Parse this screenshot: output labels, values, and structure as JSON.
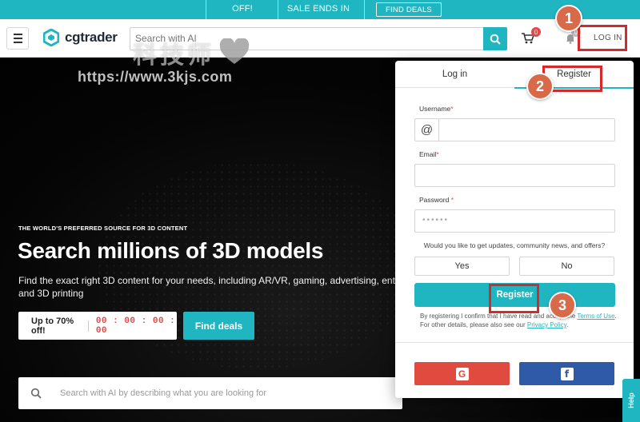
{
  "promo": {
    "off_text": "OFF!",
    "sale_text": "SALE ENDS IN",
    "deals_button": "FIND DEALS"
  },
  "header": {
    "logo_text": "cgtrader",
    "search_placeholder": "Search with AI",
    "cart_count": "0",
    "notif_count": "0",
    "login_label": "LOG IN"
  },
  "watermark": {
    "title": "科技师",
    "url": "https://www.3kjs.com"
  },
  "hero": {
    "eyebrow": "THE WORLD'S PREFERRED SOURCE FOR 3D CONTENT",
    "headline": "Search millions of 3D models",
    "subline": "Find the exact right 3D content for your needs, including AR/VR, gaming, advertising, entertainment",
    "subline2": "and 3D printing",
    "promo_label": "Up to 70% off!",
    "timer": "00 : 00 : 00 : 00",
    "find_deals": "Find deals",
    "search_placeholder": "Search with AI by describing what you are looking for"
  },
  "modal": {
    "tab_login": "Log in",
    "tab_register": "Register",
    "username_label": "Username",
    "email_label": "Email",
    "password_label": "Password",
    "required_mark": "*",
    "password_mask": "••••••",
    "question": "Would you like to get updates, community news, and offers?",
    "yes": "Yes",
    "no": "No",
    "register_button": "Register",
    "terms_prefix": "By registering I confirm that I have read and accept the ",
    "terms_link": "Terms of Use",
    "terms_middle": ". For other details, please also see our ",
    "privacy_link": "Privacy Policy",
    "terms_suffix": ".",
    "google_glyph": "G",
    "facebook_glyph": "f"
  },
  "annotations": {
    "step1": "1",
    "step2": "2",
    "step3": "3"
  },
  "help": {
    "label": "Help"
  },
  "colors": {
    "brand": "#1fb6c1",
    "annotation_red": "#d62a2a",
    "step_circle": "#d86a4a",
    "google": "#e04a3f",
    "facebook": "#2e5aa8"
  }
}
